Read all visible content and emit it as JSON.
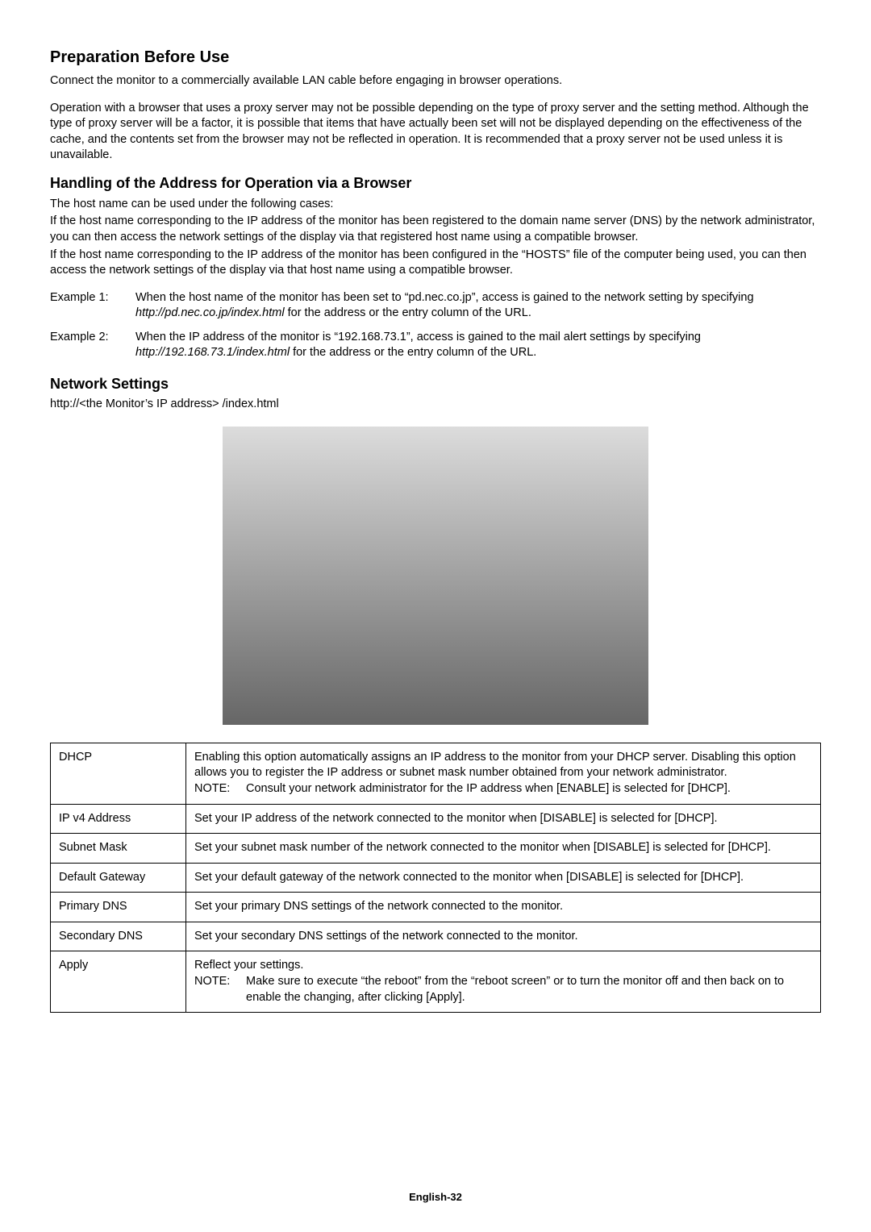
{
  "heading1": "Preparation Before Use",
  "para1": "Connect the monitor to a commercially available LAN cable before engaging in browser operations.",
  "para2": "Operation with a browser that uses a proxy server may not be possible depending on the type of proxy server and the setting method. Although the type of proxy server will be a factor, it is possible that items that have actually been set will not be displayed depending on the effectiveness of the cache, and the contents set from the browser may not be reflected in operation. It is recommended that a proxy server not be used unless it is unavailable.",
  "heading2": "Handling of the Address for Operation via a Browser",
  "para3a": "The host name can be used under the following cases:",
  "para3b": "If the host name corresponding to the IP address of the monitor has been registered to the domain name server (DNS) by the network administrator, you can then access the network settings of the display via that registered host name using a compatible browser.",
  "para3c": "If the host name corresponding to the IP address of the monitor has been configured in the “HOSTS” file of the computer being used, you can then access the network settings of the display via that host name using a compatible browser.",
  "example1_label": "Example 1:",
  "example1_pre": "When the host name of the monitor has been set to “pd.nec.co.jp”, access is gained to the network setting by specifying ",
  "example1_url": "http://pd.nec.co.jp/index.html",
  "example1_post": " for the address or the entry column of the URL.",
  "example2_label": "Example 2:",
  "example2_pre": "When the IP address of the monitor is “192.168.73.1”, access is gained to the mail alert settings by specifying ",
  "example2_url": "http://192.168.73.1/index.html",
  "example2_post": " for the address or the entry column of the URL.",
  "heading3": "Network Settings",
  "url_line": "http://<the Monitor’s IP address> /index.html",
  "table": {
    "rows": [
      {
        "name": "DHCP",
        "desc": "Enabling this option automatically assigns an IP address to the monitor from your DHCP server. Disabling this option allows you to register the IP address or subnet mask number obtained from your network administrator.",
        "note_label": "NOTE:",
        "note_body": "Consult your network administrator for the IP address when [ENABLE] is selected for [DHCP]."
      },
      {
        "name": "IP v4 Address",
        "desc": "Set your IP address of the network connected to the monitor when [DISABLE] is selected for [DHCP]."
      },
      {
        "name": "Subnet Mask",
        "desc": "Set your subnet mask number of the network connected to the monitor when [DISABLE] is selected for [DHCP]."
      },
      {
        "name": "Default Gateway",
        "desc": "Set your default gateway of the network connected to the monitor when [DISABLE] is selected for [DHCP]."
      },
      {
        "name": "Primary DNS",
        "desc": "Set your primary DNS settings of the network connected to the monitor."
      },
      {
        "name": "Secondary DNS",
        "desc": "Set your secondary DNS settings of the network connected to the monitor."
      },
      {
        "name": "Apply",
        "desc": "Reflect your settings.",
        "note_label": "NOTE:",
        "note_body": "Make sure to execute “the reboot” from the “reboot screen” or to turn the monitor off and then back on to enable the changing, after clicking [Apply]."
      }
    ]
  },
  "footer": "English-32"
}
